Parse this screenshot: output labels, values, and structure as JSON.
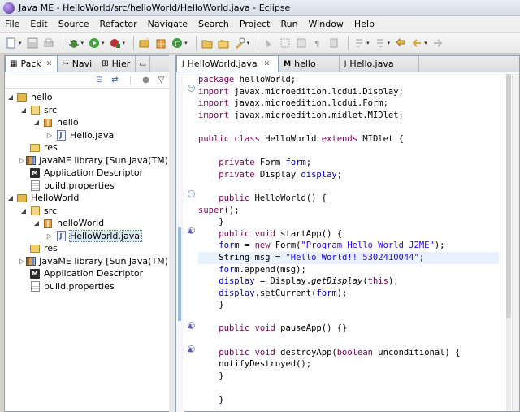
{
  "window": {
    "title": "Java ME - HelloWorld/src/helloWorld/HelloWorld.java - Eclipse"
  },
  "menu": [
    "File",
    "Edit",
    "Source",
    "Refactor",
    "Navigate",
    "Search",
    "Project",
    "Run",
    "Window",
    "Help"
  ],
  "left_tabs": [
    {
      "label": "Pack",
      "active": true
    },
    {
      "label": "Navi",
      "active": false
    },
    {
      "label": "Hier",
      "active": false
    }
  ],
  "tree": [
    {
      "label": "hello",
      "level": 0,
      "toggle": "expanded",
      "icon": "project-icon"
    },
    {
      "label": "src",
      "level": 1,
      "toggle": "expanded",
      "icon": "source-folder-icon"
    },
    {
      "label": "hello",
      "level": 2,
      "toggle": "expanded",
      "icon": "package-icon"
    },
    {
      "label": "Hello.java",
      "level": 3,
      "toggle": "collapsed",
      "icon": "java-file-icon"
    },
    {
      "label": "res",
      "level": 1,
      "toggle": "none",
      "icon": "folder-icon"
    },
    {
      "label": "JavaME library [Sun Java(TM) Wir",
      "level": 1,
      "toggle": "collapsed",
      "icon": "library-icon"
    },
    {
      "label": "Application Descriptor",
      "level": 1,
      "toggle": "none",
      "icon": "descriptor-icon"
    },
    {
      "label": "build.properties",
      "level": 1,
      "toggle": "none",
      "icon": "properties-icon"
    },
    {
      "label": "HelloWorld",
      "level": 0,
      "toggle": "expanded",
      "icon": "project-icon"
    },
    {
      "label": "src",
      "level": 1,
      "toggle": "expanded",
      "icon": "source-folder-icon"
    },
    {
      "label": "helloWorld",
      "level": 2,
      "toggle": "expanded",
      "icon": "package-icon"
    },
    {
      "label": "HelloWorld.java",
      "level": 3,
      "toggle": "collapsed",
      "icon": "java-file-icon",
      "selected": true
    },
    {
      "label": "res",
      "level": 1,
      "toggle": "none",
      "icon": "folder-icon"
    },
    {
      "label": "JavaME library [Sun Java(TM) Wir",
      "level": 1,
      "toggle": "collapsed",
      "icon": "library-icon"
    },
    {
      "label": "Application Descriptor",
      "level": 1,
      "toggle": "none",
      "icon": "descriptor-icon"
    },
    {
      "label": "build.properties",
      "level": 1,
      "toggle": "none",
      "icon": "properties-icon"
    }
  ],
  "editor_tabs": [
    {
      "label": "HelloWorld.java",
      "active": true,
      "icon": "java-file-icon"
    },
    {
      "label": "hello",
      "active": false,
      "icon": "descriptor-icon"
    },
    {
      "label": "Hello.java",
      "active": false,
      "icon": "java-file-icon"
    }
  ],
  "code_lines": [
    "package helloWorld;",
    "import javax.microedition.lcdui.Display;",
    "import javax.microedition.lcdui.Form;",
    "import javax.microedition.midlet.MIDlet;",
    "",
    "public class HelloWorld extends MIDlet {",
    "",
    "    private Form form;",
    "    private Display display;",
    "",
    "    public HelloWorld() {",
    "super();",
    "    }",
    "    public void startApp() {",
    "    form = new Form(\"Program Hello World J2ME\");",
    "    String msg = \"Hello World!! 5302410044\";",
    "    form.append(msg);",
    "    display = Display.getDisplay(this);",
    "    display.setCurrent(form);",
    "    }",
    "",
    "    public void pauseApp() {}",
    "",
    "    public void destroyApp(boolean unconditional) {",
    "    notifyDestroyed();",
    "    }",
    "",
    "    }"
  ],
  "highlighted_line": 15,
  "colors": {
    "keyword": "#7f0055",
    "field": "#0000c0",
    "string": "#2a00ff",
    "line_highlight": "#e8f2fe"
  }
}
